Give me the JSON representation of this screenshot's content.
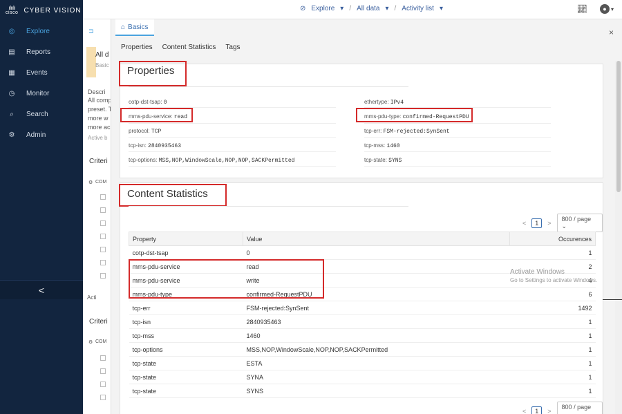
{
  "brand": {
    "mark": "cisco",
    "name": "CYBER VISION"
  },
  "sidebar": {
    "items": [
      {
        "label": "Explore",
        "icon": "compass-icon",
        "active": true
      },
      {
        "label": "Reports",
        "icon": "document-icon"
      },
      {
        "label": "Events",
        "icon": "calendar-icon"
      },
      {
        "label": "Monitor",
        "icon": "monitor-icon"
      },
      {
        "label": "Search",
        "icon": "search-icon"
      },
      {
        "label": "Admin",
        "icon": "gear-icon"
      }
    ],
    "collapse_glyph": "<"
  },
  "topbar": {
    "explore": "Explore",
    "all_data": "All data",
    "activity_list": "Activity list"
  },
  "background": {
    "title_frag": "All d",
    "basic_frag": "Basic",
    "desc_lines": [
      "Descri",
      "All comp",
      "preset. T",
      "more w",
      "more ac",
      "Active b"
    ],
    "criteria": "Criteri",
    "com": "COM",
    "criteria2": "Criteri",
    "com2": "COM",
    "act": "Acti"
  },
  "panel": {
    "tab": "Basics",
    "subtabs": [
      "Properties",
      "Content Statistics",
      "Tags"
    ],
    "close": "×"
  },
  "properties": {
    "title": "Properties",
    "left": [
      {
        "key": "cotp-dst-tsap",
        "value": "0"
      },
      {
        "key": "mms-pdu-service",
        "value": "read"
      },
      {
        "key": "protocol",
        "value": "TCP"
      },
      {
        "key": "tcp-isn",
        "value": "2840935463"
      },
      {
        "key": "tcp-options",
        "value": "MSS,NOP,WindowScale,NOP,NOP,SACKPermitted"
      }
    ],
    "right": [
      {
        "key": "ethertype",
        "value": "IPv4"
      },
      {
        "key": "mms-pdu-type",
        "value": "confirmed-RequestPDU"
      },
      {
        "key": "tcp-err",
        "value": "FSM-rejected:SynSent"
      },
      {
        "key": "tcp-mss",
        "value": "1460"
      },
      {
        "key": "tcp-state",
        "value": "SYNS"
      }
    ]
  },
  "content_statistics": {
    "title": "Content Statistics",
    "pager": {
      "prev": "<",
      "page": "1",
      "next": ">",
      "size": "800 / page"
    },
    "columns": [
      "Property",
      "Value",
      "Occurences"
    ],
    "rows": [
      [
        "cotp-dst-tsap",
        "0",
        "1"
      ],
      [
        "mms-pdu-service",
        "read",
        "2"
      ],
      [
        "mms-pdu-service",
        "write",
        "4"
      ],
      [
        "mms-pdu-type",
        "confirmed-RequestPDU",
        "6"
      ],
      [
        "tcp-err",
        "FSM-rejected:SynSent",
        "1492"
      ],
      [
        "tcp-isn",
        "2840935463",
        "1"
      ],
      [
        "tcp-mss",
        "1460",
        "1"
      ],
      [
        "tcp-options",
        "MSS,NOP,WindowScale,NOP,NOP,SACKPermitted",
        "1"
      ],
      [
        "tcp-state",
        "ESTA",
        "1"
      ],
      [
        "tcp-state",
        "SYNA",
        "1"
      ],
      [
        "tcp-state",
        "SYNS",
        "1"
      ]
    ]
  },
  "watermark": {
    "line1": "Activate Windows",
    "line2": "Go to Settings to activate Windows."
  },
  "colors": {
    "sidebar": "#12253f",
    "accent": "#4aa3df",
    "highlight": "#d42a2a"
  }
}
